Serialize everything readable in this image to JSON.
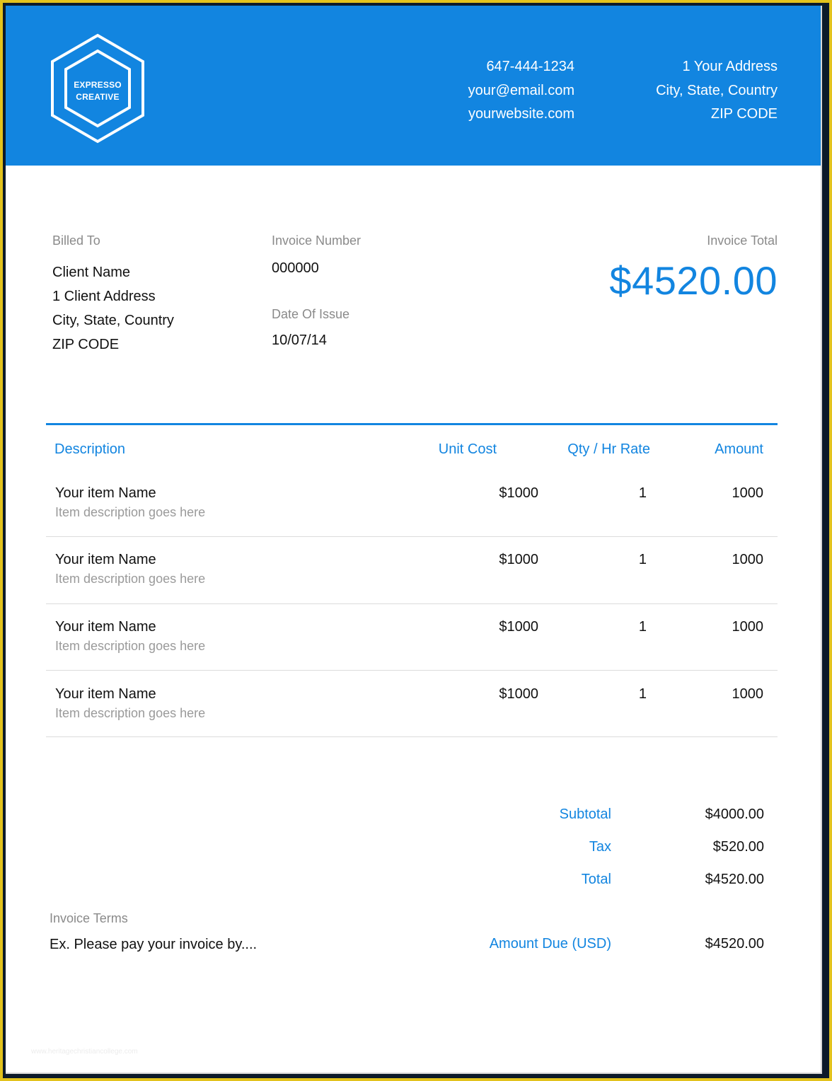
{
  "colors": {
    "accent": "#1285e0",
    "frame": "#e2c21d"
  },
  "logo": {
    "line1": "EXPRESSO",
    "line2": "CREATIVE"
  },
  "contact": {
    "phone": "647-444-1234",
    "email": "your@email.com",
    "website": "yourwebsite.com"
  },
  "address": {
    "line1": "1 Your Address",
    "line2": "City, State, Country",
    "line3": "ZIP CODE"
  },
  "billed_to": {
    "label": "Billed To",
    "name": "Client Name",
    "address1": "1 Client Address",
    "address2": "City, State, Country",
    "zip": "ZIP CODE"
  },
  "invoice_number": {
    "label": "Invoice Number",
    "value": "000000"
  },
  "date_of_issue": {
    "label": "Date Of Issue",
    "value": "10/07/14"
  },
  "invoice_total": {
    "label": "Invoice Total",
    "value": "$4520.00"
  },
  "table": {
    "headers": {
      "description": "Description",
      "unit_cost": "Unit Cost",
      "qty": "Qty / Hr Rate",
      "amount": "Amount"
    },
    "rows": [
      {
        "name": "Your item Name",
        "desc": "Item description goes here",
        "cost": "$1000",
        "qty": "1",
        "amount": "1000"
      },
      {
        "name": "Your item Name",
        "desc": "Item description goes here",
        "cost": "$1000",
        "qty": "1",
        "amount": "1000"
      },
      {
        "name": "Your item Name",
        "desc": "Item description goes here",
        "cost": "$1000",
        "qty": "1",
        "amount": "1000"
      },
      {
        "name": "Your item Name",
        "desc": "Item description goes here",
        "cost": "$1000",
        "qty": "1",
        "amount": "1000"
      }
    ]
  },
  "summary": {
    "subtotal_label": "Subtotal",
    "subtotal": "$4000.00",
    "tax_label": "Tax",
    "tax": "$520.00",
    "total_label": "Total",
    "total": "$4520.00",
    "due_label": "Amount Due (USD)",
    "due": "$4520.00"
  },
  "terms": {
    "label": "Invoice Terms",
    "text": "Ex. Please pay your invoice by...."
  },
  "watermark": "www.heritagechristiancollege.com"
}
